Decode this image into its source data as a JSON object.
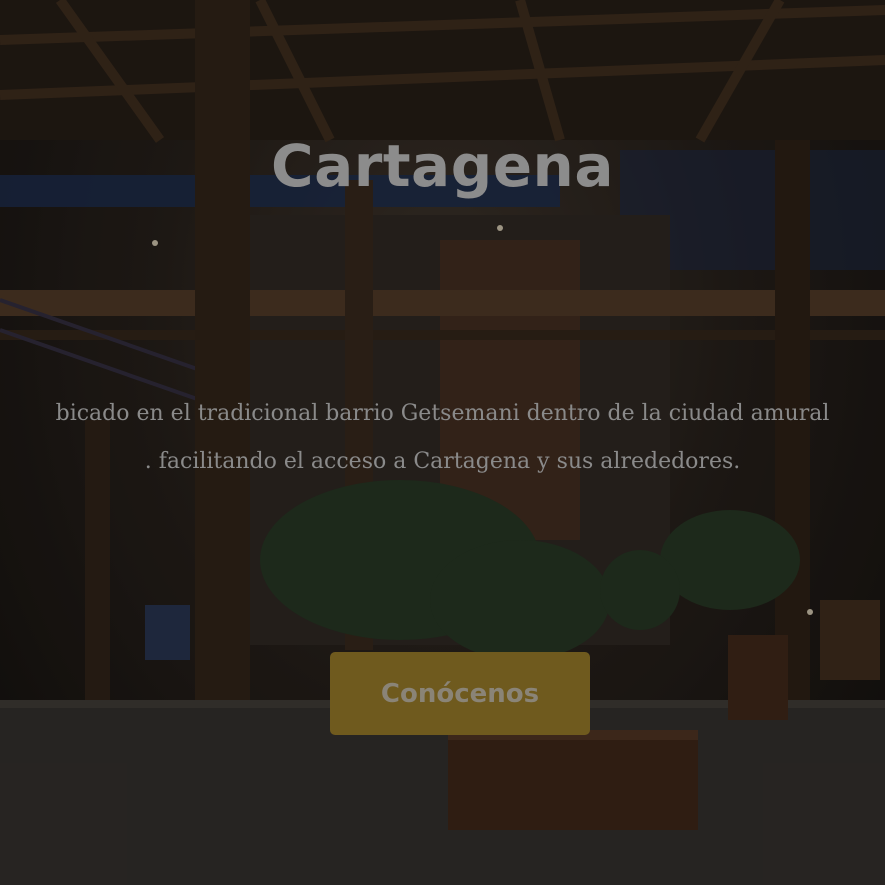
{
  "hero": {
    "title": "Cartagena",
    "subtitle_line1": "bicado en el tradicional barrio Getsemani dentro de la ciudad amural",
    "subtitle_line2": ". facilitando el acceso a Cartagena y sus alrededores.",
    "cta_label": "Conócenos"
  },
  "colors": {
    "overlay": "#000000",
    "cta_background": "#6f5a1e",
    "text": "#8c8c8c"
  }
}
